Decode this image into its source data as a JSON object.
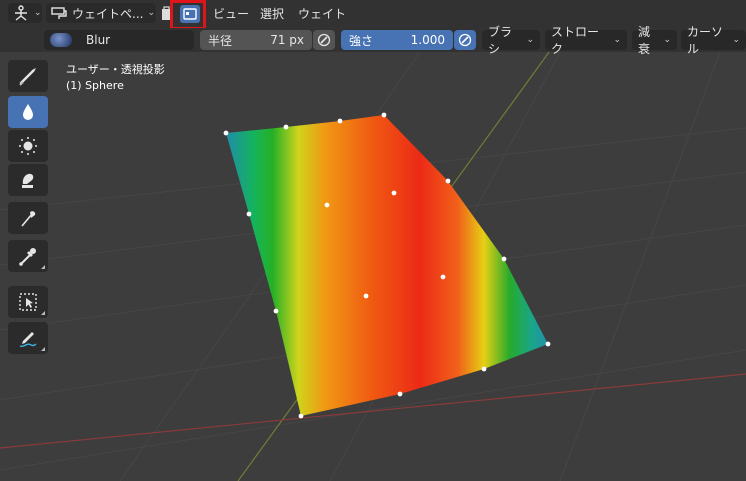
{
  "header": {
    "editor_type_icon": "object-mode-icon",
    "mode_label": "ウェイトペ...",
    "mode_icon": "weight-paint-icon",
    "toggle_icon": "vertex-select-icon",
    "menu": [
      "ビュー",
      "選択",
      "ウェイト"
    ]
  },
  "tool_settings": {
    "brush_name": "Blur",
    "radius_label": "半径",
    "radius_value": "71 px",
    "strength_label": "強さ",
    "strength_value": "1.000",
    "dropdowns": [
      "ブラシ",
      "ストローク",
      "減衰",
      "カーソル"
    ]
  },
  "viewport": {
    "view_name": "ユーザー・透視投影",
    "object_name": "(1) Sphere"
  },
  "toolbar": {
    "tools": [
      "draw-brush-icon",
      "blur-brush-icon",
      "average-brush-icon",
      "smear-brush-icon",
      "gradient-icon",
      "sample-weight-icon",
      "select-box-icon",
      "annotate-icon"
    ],
    "active": "blur-brush-icon"
  },
  "colors": {
    "highlight_box": "#e0141b",
    "accent": "#4772b3",
    "background": "#3d3d3d"
  }
}
